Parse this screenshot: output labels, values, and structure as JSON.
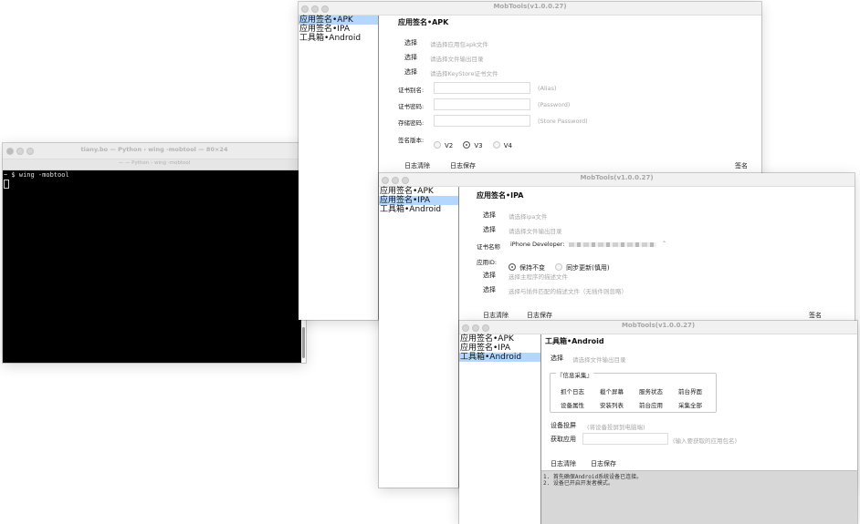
{
  "terminal": {
    "title": "tiany.bo — Python › wing -mobtool — 80×24",
    "subtitle": "— — Python › wing -mobtool",
    "prompt_line": "~ $ wing -mobtool"
  },
  "sidebar_items": [
    "应用签名•APK",
    "应用签名•IPA",
    "工具箱•Android"
  ],
  "apk_window": {
    "title": "MobTools(v1.0.0.27)",
    "heading": "应用签名•APK",
    "select_label": "选择",
    "select_apk_hint": "请选择应用包apk文件",
    "select_out_hint": "请选择文件输出目录",
    "select_keystore_hint": "请选择KeyStore证书文件",
    "alias_label": "证书别名:",
    "alias_hint": "(Alias)",
    "password_label": "证书密码:",
    "password_hint": "(Password)",
    "store_label": "存储密码:",
    "store_hint": "(Store Password)",
    "version_label": "签名版本:",
    "v2": "V2",
    "v3": "V3",
    "v4": "V4",
    "clear_log": "日志清除",
    "save_log": "日志保存",
    "sign": "签名"
  },
  "ipa_window": {
    "title": "MobTools(v1.0.0.27)",
    "heading": "应用签名•IPA",
    "select_label": "选择",
    "select_ipa_hint": "请选择ipa文件",
    "select_out_hint": "请选择文件输出目录",
    "cert_label": "证书名称",
    "cert_value": "iPhone Developer:",
    "appid_label": "应用ID:",
    "keep": "保持不变",
    "sync": "同步更新(慎用)",
    "select_main_hint": "选择主程序的描述文件",
    "select_ext_hint": "选择与插件匹配的描述文件（无插件则忽略）",
    "clear_log": "日志清除",
    "save_log": "日志保存",
    "sign": "签名"
  },
  "android_window": {
    "title": "MobTools(v1.0.0.27)",
    "heading": "工具箱•Android",
    "select_label": "选择",
    "select_out_hint": "请选择文件输出目录",
    "group_title": "『信息采集』",
    "buttons_row1": [
      "抓个日志",
      "截个屏幕",
      "服务状态",
      "前台界面"
    ],
    "buttons_row2": [
      "设备属性",
      "安装列表",
      "前台应用",
      "采集全部"
    ],
    "mirror_btn": "设备投屏",
    "mirror_hint": "(将设备投屏到电脑端)",
    "fetch_btn": "获取应用",
    "fetch_hint": "(输入要获取的应用包名)",
    "clear_log": "日志清除",
    "save_log": "日志保存",
    "log_lines": [
      "1. 首先确保Android系统设备已连接。",
      "2. 设备已开启开发者模式。"
    ]
  }
}
